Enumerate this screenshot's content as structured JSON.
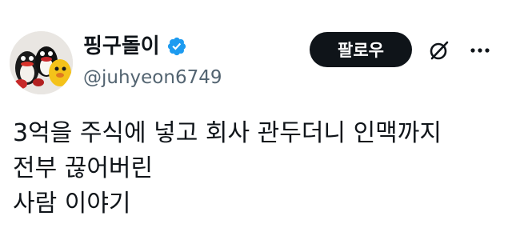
{
  "author": {
    "display_name": "핑구돌이",
    "handle": "@juhyeon6749",
    "verified_color": "#1d9bf0",
    "avatar_icon": "pingu-plush-avatar"
  },
  "actions": {
    "follow_label": "팔로우",
    "grok_icon": "grok-icon",
    "more_icon": "more-dots-icon"
  },
  "tweet": {
    "text": "3억을 주식에 넣고 회사 관두더니 인맥까지\n전부 끊어버린\n사람 이야기"
  }
}
